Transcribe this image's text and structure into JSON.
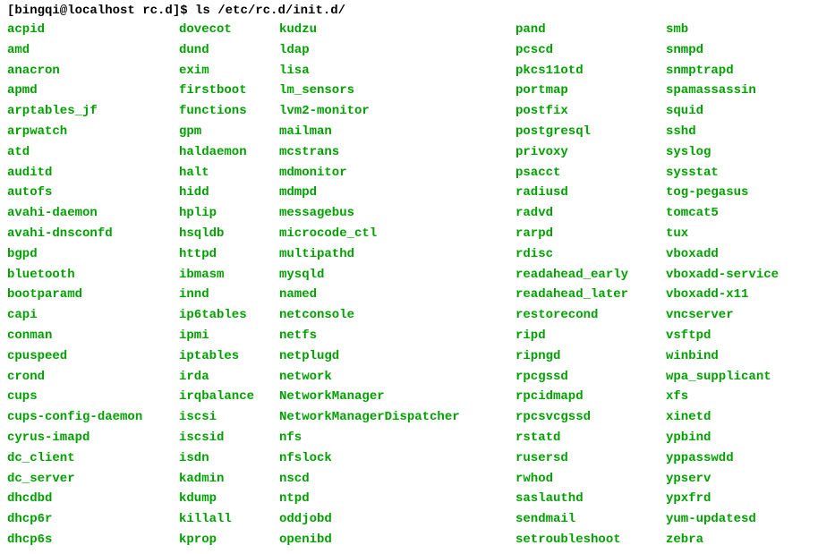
{
  "prompt": "[bingqi@localhost rc.d]$ ls /etc/rc.d/init.d/",
  "cols": [
    [
      "acpid",
      "amd",
      "anacron",
      "apmd",
      "arptables_jf",
      "arpwatch",
      "atd",
      "auditd",
      "autofs",
      "avahi-daemon",
      "avahi-dnsconfd",
      "bgpd",
      "bluetooth",
      "bootparamd",
      "capi",
      "conman",
      "cpuspeed",
      "crond",
      "cups",
      "cups-config-daemon",
      "cyrus-imapd",
      "dc_client",
      "dc_server",
      "dhcdbd",
      "dhcp6r",
      "dhcp6s"
    ],
    [
      "dovecot",
      "dund",
      "exim",
      "firstboot",
      "functions",
      "gpm",
      "haldaemon",
      "halt",
      "hidd",
      "hplip",
      "hsqldb",
      "httpd",
      "ibmasm",
      "innd",
      "ip6tables",
      "ipmi",
      "iptables",
      "irda",
      "irqbalance",
      "iscsi",
      "iscsid",
      "isdn",
      "kadmin",
      "kdump",
      "killall",
      "kprop"
    ],
    [
      "kudzu",
      "ldap",
      "lisa",
      "lm_sensors",
      "lvm2-monitor",
      "mailman",
      "mcstrans",
      "mdmonitor",
      "mdmpd",
      "messagebus",
      "microcode_ctl",
      "multipathd",
      "mysqld",
      "named",
      "netconsole",
      "netfs",
      "netplugd",
      "network",
      "NetworkManager",
      "NetworkManagerDispatcher",
      "nfs",
      "nfslock",
      "nscd",
      "ntpd",
      "oddjobd",
      "openibd"
    ],
    [
      "pand",
      "pcscd",
      "pkcs11otd",
      "portmap",
      "postfix",
      "postgresql",
      "privoxy",
      "psacct",
      "radiusd",
      "radvd",
      "rarpd",
      "rdisc",
      "readahead_early",
      "readahead_later",
      "restorecond",
      "ripd",
      "ripngd",
      "rpcgssd",
      "rpcidmapd",
      "rpcsvcgssd",
      "rstatd",
      "rusersd",
      "rwhod",
      "saslauthd",
      "sendmail",
      "setroubleshoot"
    ],
    [
      "smb",
      "snmpd",
      "snmptrapd",
      "spamassassin",
      "squid",
      "sshd",
      "syslog",
      "sysstat",
      "tog-pegasus",
      "tomcat5",
      "tux",
      "vboxadd",
      "vboxadd-service",
      "vboxadd-x11",
      "vncserver",
      "vsftpd",
      "winbind",
      "wpa_supplicant",
      "xfs",
      "xinetd",
      "ypbind",
      "yppasswdd",
      "ypserv",
      "ypxfrd",
      "yum-updatesd",
      "zebra"
    ]
  ]
}
